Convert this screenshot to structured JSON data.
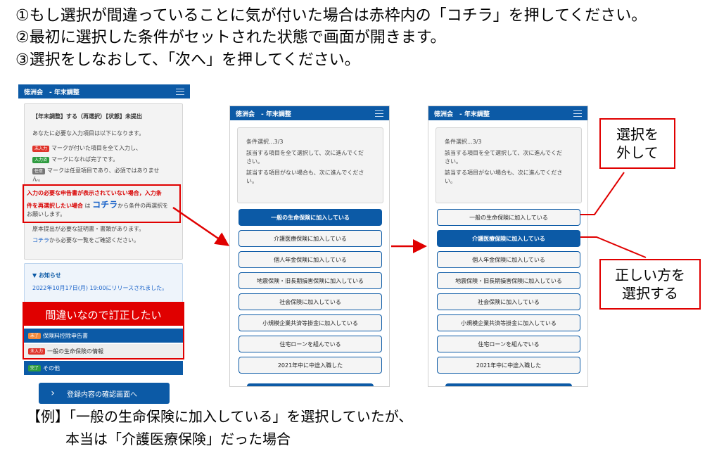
{
  "instructions": [
    "①もし選択が間違っていることに気が付いた場合は赤枠内の「コチラ」を押してください。",
    "②最初に選択した条件がセットされた状態で画面が開きます。",
    "③選択をしなおして、「次へ」を押してください。"
  ],
  "app_title": "徳洲会　- 年末調整",
  "screen1": {
    "status": "【年末調整】する（再選択）【状態】未提出",
    "intro": "あなたに必要な入力項目は以下になります。",
    "legend": [
      {
        "badge": "未入力",
        "text": "マークが付いた項目を全て入力し、"
      },
      {
        "badge": "入力済",
        "text": "マークになれば完了です。"
      },
      {
        "badge": "任意",
        "text": "マークは任意項目であり、必須ではありませ"
      }
    ],
    "legend_tail": "ん。",
    "notice_line1": "入力の必要な申告書が表示されていない場合，入力条",
    "notice_line2": "件を再選択したい場合",
    "notice_ha": "は",
    "notice_kochira": "コチラ",
    "notice_line2_tail": "から条件の再選択を",
    "notice_line3": "お願いします。",
    "original_docs": "原本提出が必要な証明書・書類があります。",
    "list_link": "コチラ",
    "list_tail": "から必要な一覧をご確認ください。",
    "news_title": "▼ お知らせ",
    "news_text": "2022年10月17日(月) 19:00にリリースされました。",
    "mistake_banner": "間違いなので訂正したい",
    "rows": [
      {
        "badge": "未了",
        "label": "保険料控除申告書"
      },
      {
        "badge": "未入力",
        "label": "一般の生命保険の情報"
      },
      {
        "badge": "完了",
        "label": "その他"
      }
    ],
    "confirm_button": "登録内容の確認画面へ",
    "confirm_chevron": "›"
  },
  "condition": {
    "step": "条件選択...3/3",
    "line1": "該当する項目を全て選択して、次に進んでくだ",
    "line1b": "さい。",
    "line2": "該当する項目がない場合も、次に進んでくださ",
    "line2b": "い。"
  },
  "options": [
    "一般の生命保険に加入している",
    "介護医療保険に加入している",
    "個人年金保険に加入している",
    "地震保険・旧長期損害保険に加入している",
    "社会保険に加入している",
    "小規模企業共済等掛金に加入している",
    "住宅ローンを組んでいる",
    "2021年中に中途入職した"
  ],
  "screen2_selected": 0,
  "screen3_selected": 1,
  "callout_deselect": [
    "選択を",
    "外して"
  ],
  "callout_select": [
    "正しい方を",
    "選択する"
  ],
  "caption_line1": "【例】「一般の生命保険に加入している」を選択していたが、",
  "caption_line2": "本当は「介護医療保険」だった場合",
  "colors": {
    "header_blue": "#0c5aa6",
    "highlight_red": "#e00000"
  }
}
